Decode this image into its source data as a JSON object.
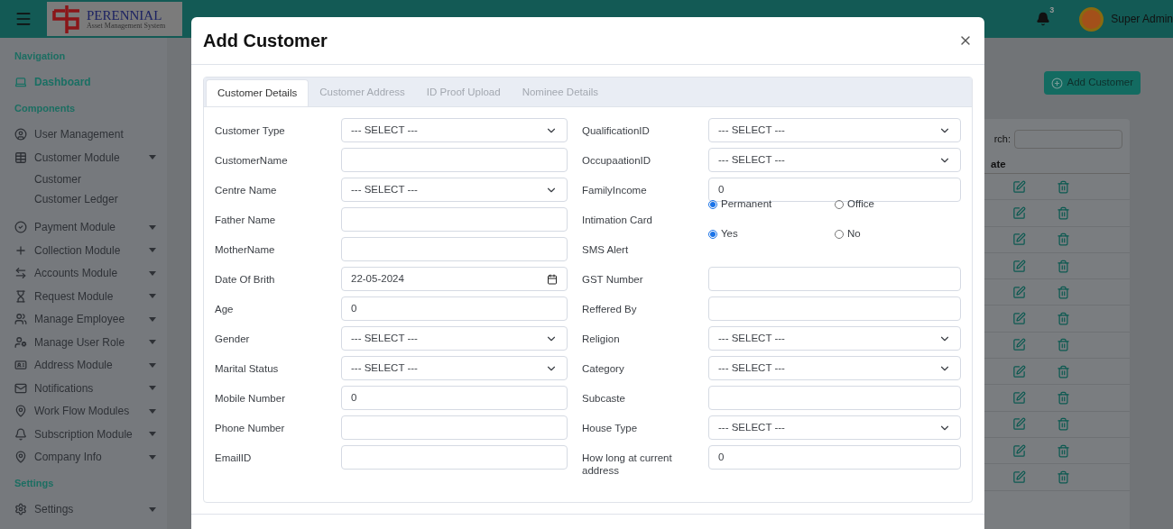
{
  "header": {
    "logo": {
      "title": "PERENNIAL",
      "subtitle": "Asset Management System"
    },
    "notification_count": "3",
    "user": "Super Admin"
  },
  "sidebar": {
    "sections": [
      {
        "title": "Navigation",
        "items": [
          {
            "label": "Dashboard",
            "selected": true,
            "expandable": false
          }
        ]
      },
      {
        "title": "Components",
        "items": [
          {
            "label": "User Management",
            "selected": false,
            "expandable": false
          },
          {
            "label": "Customer Module",
            "selected": false,
            "expandable": true,
            "children": [
              {
                "label": "Customer",
                "selected": false
              },
              {
                "label": "Customer Ledger",
                "selected": false
              }
            ]
          },
          {
            "label": "Payment Module",
            "selected": false,
            "expandable": true
          },
          {
            "label": "Collection Module",
            "selected": false,
            "expandable": true
          },
          {
            "label": "Accounts Module",
            "selected": false,
            "expandable": true
          },
          {
            "label": "Request Module",
            "selected": false,
            "expandable": true
          },
          {
            "label": "Manage Employee",
            "selected": false,
            "expandable": true
          },
          {
            "label": "Manage User Role",
            "selected": false,
            "expandable": true
          },
          {
            "label": "Address Module",
            "selected": false,
            "expandable": true
          },
          {
            "label": "Notifications",
            "selected": false,
            "expandable": true
          },
          {
            "label": "Work Flow Modules",
            "selected": false,
            "expandable": true
          },
          {
            "label": "Subscription Module",
            "selected": false,
            "expandable": true
          },
          {
            "label": "Company Info",
            "selected": false,
            "expandable": true
          }
        ]
      },
      {
        "title": "Settings",
        "items": [
          {
            "label": "Settings",
            "selected": false,
            "expandable": true
          }
        ]
      }
    ]
  },
  "main": {
    "add_button": "Add Customer",
    "table": {
      "search_label": "rch:",
      "column": "ate"
    }
  },
  "modal": {
    "title": "Add Customer",
    "tabs": [
      {
        "label": "Customer Details",
        "selected": true
      },
      {
        "label": "Customer Address",
        "selected": false
      },
      {
        "label": "ID Proof Upload",
        "selected": false
      },
      {
        "label": "Nominee Details",
        "selected": false
      }
    ],
    "left_fields": [
      {
        "label": "Customer Type",
        "kind": "select",
        "value": "--- SELECT ---"
      },
      {
        "label": "CustomerName",
        "kind": "text"
      },
      {
        "label": "Centre Name",
        "kind": "select",
        "value": "--- SELECT ---"
      },
      {
        "label": "Father Name",
        "kind": "text"
      },
      {
        "label": "MotherName",
        "kind": "text"
      },
      {
        "label": "Date Of Brith",
        "kind": "date",
        "value": "22-05-2024"
      },
      {
        "label": "Age",
        "kind": "text",
        "value": "0"
      },
      {
        "label": "Gender",
        "kind": "select",
        "value": "--- SELECT ---"
      },
      {
        "label": "Marital Status",
        "kind": "select",
        "value": "--- SELECT ---"
      },
      {
        "label": "Mobile Number",
        "kind": "text",
        "value": "0"
      },
      {
        "label": "Phone Number",
        "kind": "text"
      },
      {
        "label": "EmailID",
        "kind": "text"
      }
    ],
    "right_fields": [
      {
        "label": "QualificationID",
        "kind": "select",
        "value": "--- SELECT ---"
      },
      {
        "label": "OccupaationID",
        "kind": "select",
        "value": "--- SELECT ---"
      },
      {
        "label": "FamilyIncome",
        "kind": "text",
        "value": "0"
      },
      {
        "label": "Intimation Card",
        "kind": "radio",
        "options": [
          {
            "label": "Permanent",
            "selected": true
          },
          {
            "label": "Office",
            "selected": false
          }
        ]
      },
      {
        "label": "SMS Alert",
        "kind": "radio",
        "options": [
          {
            "label": "Yes",
            "selected": true
          },
          {
            "label": "No",
            "selected": false
          }
        ]
      },
      {
        "label": "GST Number",
        "kind": "text"
      },
      {
        "label": "Reffered By",
        "kind": "text"
      },
      {
        "label": "Religion",
        "kind": "select",
        "value": "--- SELECT ---"
      },
      {
        "label": "Category",
        "kind": "select",
        "value": "--- SELECT ---"
      },
      {
        "label": "Subcaste",
        "kind": "text"
      },
      {
        "label": "House Type",
        "kind": "select",
        "value": "--- SELECT ---"
      },
      {
        "label": "How long at current address",
        "kind": "text",
        "value": "0"
      }
    ]
  }
}
